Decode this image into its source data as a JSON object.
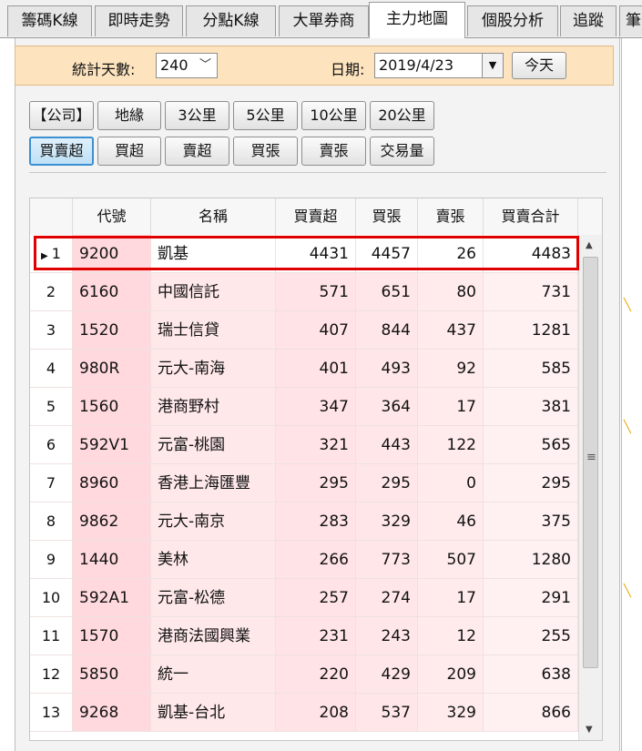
{
  "tabs": [
    {
      "label": "籌碼K線",
      "active": false
    },
    {
      "label": "即時走勢",
      "active": false
    },
    {
      "label": "分點K線",
      "active": false
    },
    {
      "label": "大單券商",
      "active": false
    },
    {
      "label": "主力地圖",
      "active": true
    },
    {
      "label": "個股分析",
      "active": false
    },
    {
      "label": "追蹤",
      "active": false
    },
    {
      "label": "筆",
      "active": false
    }
  ],
  "filter": {
    "days_label": "統計天數:",
    "days_value": "240",
    "date_label": "日期:",
    "date_value": "2019/4/23",
    "today_button": "今天"
  },
  "range_buttons": [
    {
      "label": "【公司】",
      "selected": false
    },
    {
      "label": "地緣",
      "selected": false
    },
    {
      "label": "3公里",
      "selected": false
    },
    {
      "label": "5公里",
      "selected": false
    },
    {
      "label": "10公里",
      "selected": false
    },
    {
      "label": "20公里",
      "selected": false
    }
  ],
  "sort_buttons": [
    {
      "label": "買賣超",
      "selected": true
    },
    {
      "label": "買超",
      "selected": false
    },
    {
      "label": "賣超",
      "selected": false
    },
    {
      "label": "買張",
      "selected": false
    },
    {
      "label": "賣張",
      "selected": false
    },
    {
      "label": "交易量",
      "selected": false
    }
  ],
  "table": {
    "columns": [
      "代號",
      "名稱",
      "買賣超",
      "買張",
      "賣張",
      "買賣合計"
    ],
    "rows": [
      {
        "idx": "1",
        "code": "9200",
        "name": "凱基",
        "net": "4431",
        "buy": "4457",
        "sell": "26",
        "total": "4483",
        "selected": true
      },
      {
        "idx": "2",
        "code": "6160",
        "name": "中國信託",
        "net": "571",
        "buy": "651",
        "sell": "80",
        "total": "731"
      },
      {
        "idx": "3",
        "code": "1520",
        "name": "瑞士信貸",
        "net": "407",
        "buy": "844",
        "sell": "437",
        "total": "1281"
      },
      {
        "idx": "4",
        "code": "980R",
        "name": "元大-南海",
        "net": "401",
        "buy": "493",
        "sell": "92",
        "total": "585"
      },
      {
        "idx": "5",
        "code": "1560",
        "name": "港商野村",
        "net": "347",
        "buy": "364",
        "sell": "17",
        "total": "381"
      },
      {
        "idx": "6",
        "code": "592V1",
        "name": "元富-桃園",
        "net": "321",
        "buy": "443",
        "sell": "122",
        "total": "565"
      },
      {
        "idx": "7",
        "code": "8960",
        "name": "香港上海匯豐",
        "net": "295",
        "buy": "295",
        "sell": "0",
        "total": "295"
      },
      {
        "idx": "8",
        "code": "9862",
        "name": "元大-南京",
        "net": "283",
        "buy": "329",
        "sell": "46",
        "total": "375"
      },
      {
        "idx": "9",
        "code": "1440",
        "name": "美林",
        "net": "266",
        "buy": "773",
        "sell": "507",
        "total": "1280"
      },
      {
        "idx": "10",
        "code": "592A1",
        "name": "元富-松德",
        "net": "257",
        "buy": "274",
        "sell": "17",
        "total": "291"
      },
      {
        "idx": "11",
        "code": "1570",
        "name": "港商法國興業",
        "net": "231",
        "buy": "243",
        "sell": "12",
        "total": "255"
      },
      {
        "idx": "12",
        "code": "5850",
        "name": "統一",
        "net": "220",
        "buy": "429",
        "sell": "209",
        "total": "638"
      },
      {
        "idx": "13",
        "code": "9268",
        "name": "凱基-台北",
        "net": "208",
        "buy": "537",
        "sell": "329",
        "total": "866"
      }
    ]
  },
  "icons": {
    "row_pointer": "triangle-right-icon",
    "dropdown": "chevron-down-icon",
    "date_dropdown": "triangle-down-icon",
    "scroll_up": "triangle-up-icon",
    "scroll_down": "triangle-down-icon",
    "scroll_grip": "grip-lines-icon"
  },
  "colors": {
    "highlight_box": "#e00000",
    "filter_bg": "#fde4bf",
    "selected_button_border": "#3c8fd1"
  }
}
